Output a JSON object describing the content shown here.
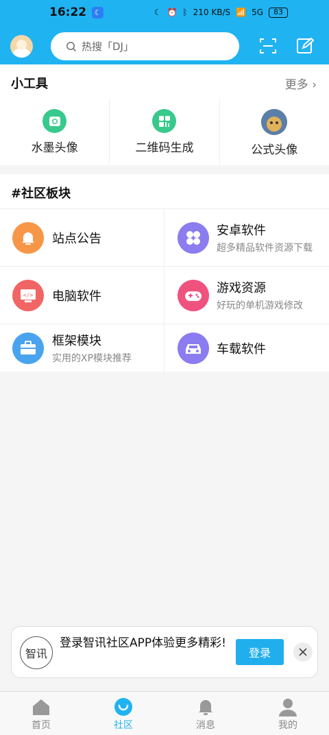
{
  "status": {
    "time": "16:22",
    "net_speed": "210 KB/S",
    "signal": "5G",
    "battery": "83"
  },
  "header": {
    "search_placeholder": "热搜「DJ」"
  },
  "tools": {
    "title": "小工具",
    "more": "更多",
    "items": [
      {
        "label": "水墨头像",
        "color": "#38c98c"
      },
      {
        "label": "二维码生成",
        "color": "#38c98c"
      },
      {
        "label": "公式头像",
        "color": "#c8a26b"
      }
    ]
  },
  "community": {
    "title": "#社区板块",
    "items": [
      {
        "title": "站点公告",
        "subtitle": "",
        "color": "#f79647"
      },
      {
        "title": "安卓软件",
        "subtitle": "超多精品软件资源下载",
        "color": "#8b7cf0"
      },
      {
        "title": "电脑软件",
        "subtitle": "",
        "color": "#f26565"
      },
      {
        "title": "游戏资源",
        "subtitle": "好玩的单机游戏修改",
        "color": "#f0527f"
      },
      {
        "title": "框架模块",
        "subtitle": "实用的XP模块推荐",
        "color": "#4aa3ef"
      },
      {
        "title": "车载软件",
        "subtitle": "",
        "color": "#8b7cf0"
      }
    ]
  },
  "login_card": {
    "logo_text": "智讯",
    "message": "登录智讯社区APP体验更多精彩!",
    "button": "登录"
  },
  "tabbar": {
    "items": [
      {
        "label": "首页"
      },
      {
        "label": "社区"
      },
      {
        "label": "消息"
      },
      {
        "label": "我的"
      }
    ]
  },
  "colors": {
    "accent": "#20b3f2"
  }
}
